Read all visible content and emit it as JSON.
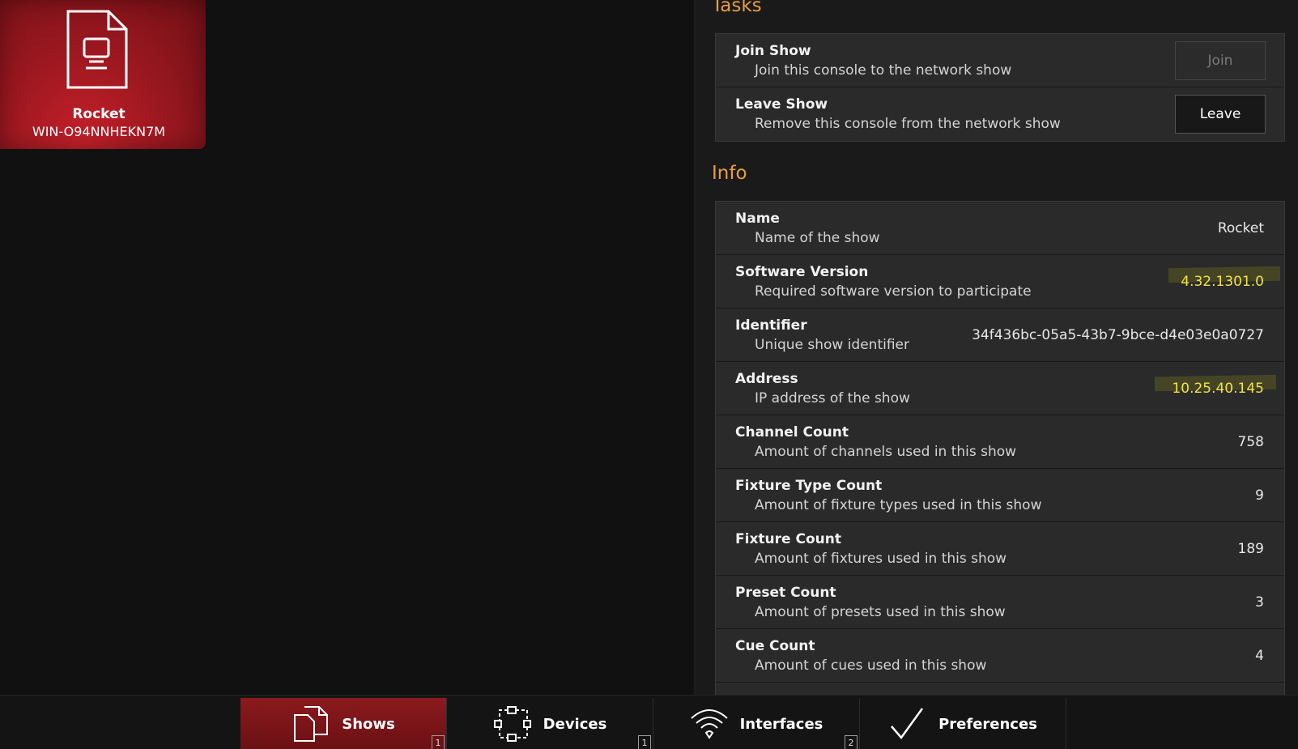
{
  "show_tile": {
    "name": "Rocket",
    "host": "WIN-O94NNHEKN7M"
  },
  "tasks": {
    "title": "Tasks",
    "rows": [
      {
        "label": "Join Show",
        "desc": "Join this console to the network show",
        "button": "Join",
        "button_enabled": false
      },
      {
        "label": "Leave Show",
        "desc": "Remove this console from the network show",
        "button": "Leave",
        "button_enabled": true
      }
    ]
  },
  "info": {
    "title": "Info",
    "rows": [
      {
        "label": "Name",
        "desc": "Name of the show",
        "value": "Rocket"
      },
      {
        "label": "Software Version",
        "desc": "Required software version to participate",
        "value": "4.32.1301.0",
        "highlighted": true
      },
      {
        "label": "Identifier",
        "desc": "Unique show identifier",
        "value": "34f436bc-05a5-43b7-9bce-d4e03e0a0727"
      },
      {
        "label": "Address",
        "desc": "IP address of the show",
        "value": "10.25.40.145",
        "highlighted": true
      },
      {
        "label": "Channel Count",
        "desc": "Amount of channels used in this show",
        "value": "758"
      },
      {
        "label": "Fixture Type Count",
        "desc": "Amount of fixture types used in this show",
        "value": "9"
      },
      {
        "label": "Fixture Count",
        "desc": "Amount of fixtures used in this show",
        "value": "189"
      },
      {
        "label": "Preset Count",
        "desc": "Amount of presets used in this show",
        "value": "3"
      },
      {
        "label": "Cue Count",
        "desc": "Amount of cues used in this show",
        "value": "4"
      }
    ]
  },
  "tabs": [
    {
      "label": "Shows",
      "icon": "documents-icon",
      "badge": "1",
      "active": true
    },
    {
      "label": "Devices",
      "icon": "network-devices-icon",
      "badge": "1",
      "active": false
    },
    {
      "label": "Interfaces",
      "icon": "wifi-icon",
      "badge": "2",
      "active": false
    },
    {
      "label": "Preferences",
      "icon": "checkmark-icon",
      "badge": "",
      "active": false
    }
  ],
  "colors": {
    "accent": "#e99d3f",
    "active_tab": "#8b1a1e",
    "tile": "#b51d26",
    "highlight_text": "#f0e24a"
  }
}
